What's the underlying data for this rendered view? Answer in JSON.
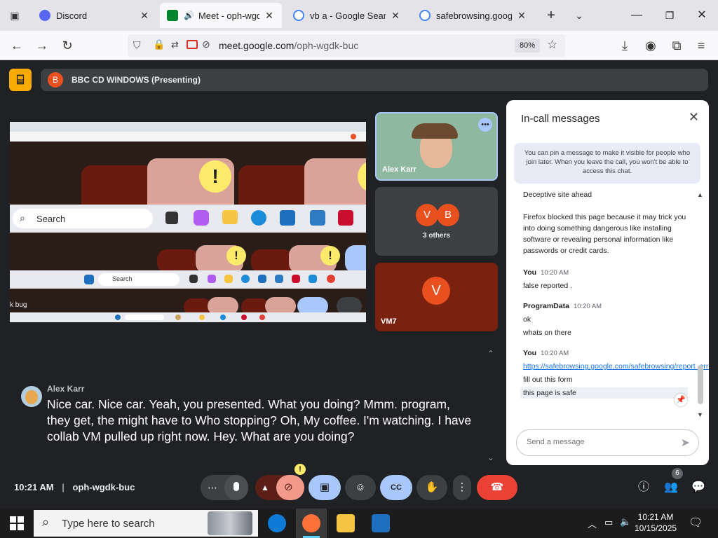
{
  "browser": {
    "tabs": [
      {
        "title": "Discord",
        "active": false,
        "icon": "discord-icon",
        "color": "#5865f2"
      },
      {
        "title": "Meet - oph-wgdk-b",
        "active": true,
        "icon": "meet-icon",
        "color": "#00832d"
      },
      {
        "title": "vb a - Google Search",
        "active": false,
        "icon": "google-icon",
        "color": "#4285f4"
      },
      {
        "title": "safebrowsing.google.co",
        "active": false,
        "icon": "google-icon",
        "color": "#4285f4"
      }
    ],
    "url_domain": "meet.google.com",
    "url_path": "/oph-wgdk-buc",
    "zoom": "80%"
  },
  "meet": {
    "presenter_initial": "B",
    "presenter_label": "BBC CD WINDOWS (Presenting)",
    "shared_screen": {
      "search_label": "Search",
      "small_search_label": "Search",
      "partial_text": "k bug"
    },
    "tiles": [
      {
        "name": "Alex Karr",
        "type": "video"
      },
      {
        "initials": [
          "V",
          "B"
        ],
        "label": "3 others"
      },
      {
        "name": "VM7",
        "initial": "V"
      }
    ],
    "caption": {
      "speaker": "Alex Karr",
      "text": "Nice car. Nice car. Yeah, you presented. What you doing? Mmm. program, they get, the might have to Who stopping? Oh, My coffee. I'm watching. I have collab VM pulled up right now. Hey. What are you doing?"
    },
    "meeting_time": "10:21 AM",
    "meeting_code": "oph-wgdk-buc",
    "people_count": "6"
  },
  "chat": {
    "title": "In-call messages",
    "info": "You can pin a message to make it visible for people who join later. When you leave the call, you won't be able to access this chat.",
    "messages": [
      {
        "lines": [
          "Deceptive site ahead"
        ]
      },
      {
        "lines": [
          "Firefox blocked this page because it may trick you into doing something dangerous like installing software or revealing personal information like passwords or credit cards."
        ]
      },
      {
        "sender": "You",
        "time": "10:20 AM",
        "lines": [
          "false reported ."
        ]
      },
      {
        "sender": "ProgramData",
        "time": "10:20 AM",
        "lines": [
          "ok",
          "whats on there"
        ]
      },
      {
        "sender": "You",
        "time": "10:20 AM",
        "link": "https://safebrowsing.google.com/safebrowsing/report_error/",
        "lines": [
          "fill out this form",
          "this page is safe"
        ]
      }
    ],
    "input_placeholder": "Send a message"
  },
  "taskbar": {
    "search_placeholder": "Type here to search",
    "time": "10:21 AM",
    "date": "10/15/2025"
  }
}
